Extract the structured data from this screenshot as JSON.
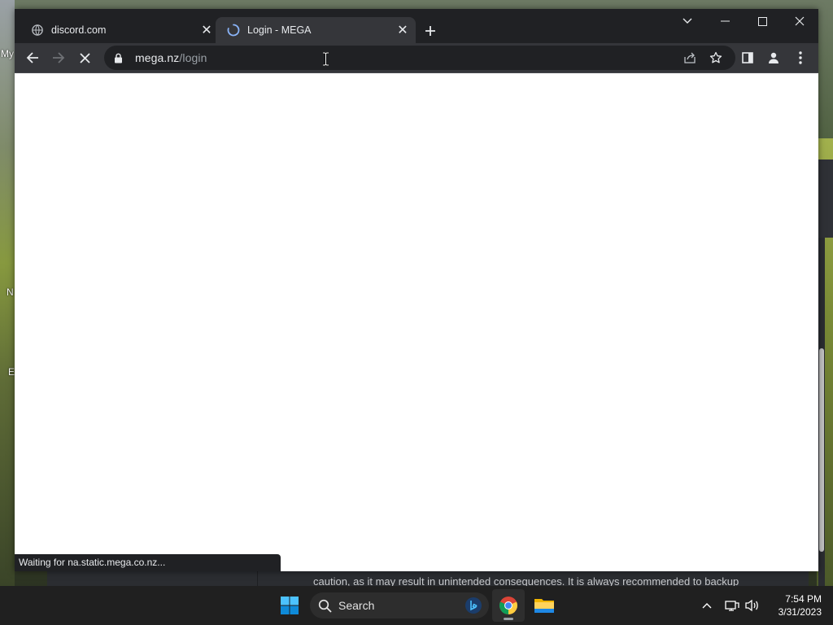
{
  "desktop": {
    "labels": [
      "My",
      "N",
      "E"
    ],
    "background_text": "caution, as it may result in unintended consequences. It is always recommended to backup"
  },
  "browser": {
    "tabs": [
      {
        "title": "discord.com",
        "active": false,
        "favicon": "globe-icon"
      },
      {
        "title": "Login - MEGA",
        "active": true,
        "favicon": "loading-spinner-icon"
      }
    ],
    "url": {
      "host": "mega.nz",
      "path": "/login"
    },
    "status": "Waiting for na.static.mega.co.nz..."
  },
  "taskbar": {
    "search_placeholder": "Search",
    "time": "7:54 PM",
    "date": "3/31/2023"
  },
  "colors": {
    "tabstrip": "#202124",
    "toolbar": "#35363a",
    "taskbar": "#202020",
    "accent_blue": "#1a73e8"
  }
}
